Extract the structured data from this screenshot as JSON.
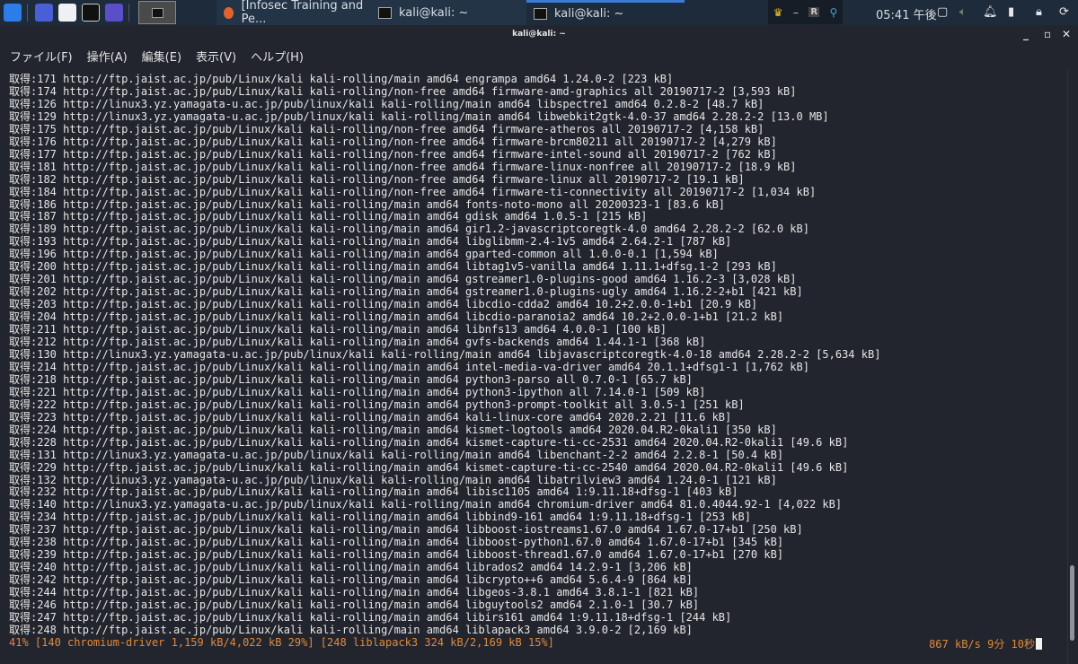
{
  "taskbar": {
    "tasks": [
      {
        "label": "[Infosec Training and Pe...",
        "icon": "firefox-icon"
      },
      {
        "label": "kali@kali: ~",
        "icon": "terminal-icon"
      },
      {
        "label": "kali@kali: ~",
        "icon": "terminal-icon",
        "active": true
      }
    ],
    "clock": "05:41 午後",
    "tray_letter": "R",
    "accent": "#3a7bd5"
  },
  "window": {
    "title": "kali@kali: ~"
  },
  "menubar": [
    "ファイル(F)",
    "操作(A)",
    "編集(E)",
    "表示(V)",
    "ヘルプ(H)"
  ],
  "terminal": {
    "lines": [
      "取得:171 http://ftp.jaist.ac.jp/pub/Linux/kali kali-rolling/main amd64 engrampa amd64 1.24.0-2 [223 kB]",
      "取得:174 http://ftp.jaist.ac.jp/pub/Linux/kali kali-rolling/non-free amd64 firmware-amd-graphics all 20190717-2 [3,593 kB]",
      "取得:126 http://linux3.yz.yamagata-u.ac.jp/pub/linux/kali kali-rolling/main amd64 libspectre1 amd64 0.2.8-2 [48.7 kB]",
      "取得:129 http://linux3.yz.yamagata-u.ac.jp/pub/linux/kali kali-rolling/main amd64 libwebkit2gtk-4.0-37 amd64 2.28.2-2 [13.0 MB]",
      "取得:175 http://ftp.jaist.ac.jp/pub/Linux/kali kali-rolling/non-free amd64 firmware-atheros all 20190717-2 [4,158 kB]",
      "取得:176 http://ftp.jaist.ac.jp/pub/Linux/kali kali-rolling/non-free amd64 firmware-brcm80211 all 20190717-2 [4,279 kB]",
      "取得:177 http://ftp.jaist.ac.jp/pub/Linux/kali kali-rolling/non-free amd64 firmware-intel-sound all 20190717-2 [762 kB]",
      "取得:181 http://ftp.jaist.ac.jp/pub/Linux/kali kali-rolling/non-free amd64 firmware-linux-nonfree all 20190717-2 [18.9 kB]",
      "取得:182 http://ftp.jaist.ac.jp/pub/Linux/kali kali-rolling/non-free amd64 firmware-linux all 20190717-2 [19.1 kB]",
      "取得:184 http://ftp.jaist.ac.jp/pub/Linux/kali kali-rolling/non-free amd64 firmware-ti-connectivity all 20190717-2 [1,034 kB]",
      "取得:186 http://ftp.jaist.ac.jp/pub/Linux/kali kali-rolling/main amd64 fonts-noto-mono all 20200323-1 [83.6 kB]",
      "取得:187 http://ftp.jaist.ac.jp/pub/Linux/kali kali-rolling/main amd64 gdisk amd64 1.0.5-1 [215 kB]",
      "取得:189 http://ftp.jaist.ac.jp/pub/Linux/kali kali-rolling/main amd64 gir1.2-javascriptcoregtk-4.0 amd64 2.28.2-2 [62.0 kB]",
      "取得:193 http://ftp.jaist.ac.jp/pub/Linux/kali kali-rolling/main amd64 libglibmm-2.4-1v5 amd64 2.64.2-1 [787 kB]",
      "取得:196 http://ftp.jaist.ac.jp/pub/Linux/kali kali-rolling/main amd64 gparted-common all 1.0.0-0.1 [1,594 kB]",
      "取得:200 http://ftp.jaist.ac.jp/pub/Linux/kali kali-rolling/main amd64 libtag1v5-vanilla amd64 1.11.1+dfsg.1-2 [293 kB]",
      "取得:201 http://ftp.jaist.ac.jp/pub/Linux/kali kali-rolling/main amd64 gstreamer1.0-plugins-good amd64 1.16.2-3 [3,028 kB]",
      "取得:202 http://ftp.jaist.ac.jp/pub/Linux/kali kali-rolling/main amd64 gstreamer1.0-plugins-ugly amd64 1.16.2-2+b1 [421 kB]",
      "取得:203 http://ftp.jaist.ac.jp/pub/Linux/kali kali-rolling/main amd64 libcdio-cdda2 amd64 10.2+2.0.0-1+b1 [20.9 kB]",
      "取得:204 http://ftp.jaist.ac.jp/pub/Linux/kali kali-rolling/main amd64 libcdio-paranoia2 amd64 10.2+2.0.0-1+b1 [21.2 kB]",
      "取得:211 http://ftp.jaist.ac.jp/pub/Linux/kali kali-rolling/main amd64 libnfs13 amd64 4.0.0-1 [100 kB]",
      "取得:212 http://ftp.jaist.ac.jp/pub/Linux/kali kali-rolling/main amd64 gvfs-backends amd64 1.44.1-1 [368 kB]",
      "取得:130 http://linux3.yz.yamagata-u.ac.jp/pub/linux/kali kali-rolling/main amd64 libjavascriptcoregtk-4.0-18 amd64 2.28.2-2 [5,634 kB]",
      "取得:214 http://ftp.jaist.ac.jp/pub/Linux/kali kali-rolling/main amd64 intel-media-va-driver amd64 20.1.1+dfsg1-1 [1,762 kB]",
      "取得:218 http://ftp.jaist.ac.jp/pub/Linux/kali kali-rolling/main amd64 python3-parso all 0.7.0-1 [65.7 kB]",
      "取得:221 http://ftp.jaist.ac.jp/pub/Linux/kali kali-rolling/main amd64 python3-ipython all 7.14.0-1 [509 kB]",
      "取得:222 http://ftp.jaist.ac.jp/pub/Linux/kali kali-rolling/main amd64 python3-prompt-toolkit all 3.0.5-1 [251 kB]",
      "取得:223 http://ftp.jaist.ac.jp/pub/Linux/kali kali-rolling/main amd64 kali-linux-core amd64 2020.2.21 [11.6 kB]",
      "取得:224 http://ftp.jaist.ac.jp/pub/Linux/kali kali-rolling/main amd64 kismet-logtools amd64 2020.04.R2-0kali1 [350 kB]",
      "取得:228 http://ftp.jaist.ac.jp/pub/Linux/kali kali-rolling/main amd64 kismet-capture-ti-cc-2531 amd64 2020.04.R2-0kali1 [49.6 kB]",
      "取得:131 http://linux3.yz.yamagata-u.ac.jp/pub/linux/kali kali-rolling/main amd64 libenchant-2-2 amd64 2.2.8-1 [50.4 kB]",
      "取得:229 http://ftp.jaist.ac.jp/pub/Linux/kali kali-rolling/main amd64 kismet-capture-ti-cc-2540 amd64 2020.04.R2-0kali1 [49.6 kB]",
      "取得:132 http://linux3.yz.yamagata-u.ac.jp/pub/linux/kali kali-rolling/main amd64 libatrilview3 amd64 1.24.0-1 [121 kB]",
      "取得:232 http://ftp.jaist.ac.jp/pub/Linux/kali kali-rolling/main amd64 libisc1105 amd64 1:9.11.18+dfsg-1 [403 kB]",
      "取得:140 http://linux3.yz.yamagata-u.ac.jp/pub/linux/kali kali-rolling/main amd64 chromium-driver amd64 81.0.4044.92-1 [4,022 kB]",
      "取得:234 http://ftp.jaist.ac.jp/pub/Linux/kali kali-rolling/main amd64 libbind9-161 amd64 1:9.11.18+dfsg-1 [253 kB]",
      "取得:237 http://ftp.jaist.ac.jp/pub/Linux/kali kali-rolling/main amd64 libboost-iostreams1.67.0 amd64 1.67.0-17+b1 [250 kB]",
      "取得:238 http://ftp.jaist.ac.jp/pub/Linux/kali kali-rolling/main amd64 libboost-python1.67.0 amd64 1.67.0-17+b1 [345 kB]",
      "取得:239 http://ftp.jaist.ac.jp/pub/Linux/kali kali-rolling/main amd64 libboost-thread1.67.0 amd64 1.67.0-17+b1 [270 kB]",
      "取得:240 http://ftp.jaist.ac.jp/pub/Linux/kali kali-rolling/main amd64 librados2 amd64 14.2.9-1 [3,206 kB]",
      "取得:242 http://ftp.jaist.ac.jp/pub/Linux/kali kali-rolling/main amd64 libcrypto++6 amd64 5.6.4-9 [864 kB]",
      "取得:244 http://ftp.jaist.ac.jp/pub/Linux/kali kali-rolling/main amd64 libgeos-3.8.1 amd64 3.8.1-1 [821 kB]",
      "取得:246 http://ftp.jaist.ac.jp/pub/Linux/kali kali-rolling/main amd64 libguytools2 amd64 2.1.0-1 [30.7 kB]",
      "取得:247 http://ftp.jaist.ac.jp/pub/Linux/kali kali-rolling/main amd64 libirs161 amd64 1:9.11.18+dfsg-1 [244 kB]",
      "取得:248 http://ftp.jaist.ac.jp/pub/Linux/kali kali-rolling/main amd64 liblapack3 amd64 3.9.0-2 [2,169 kB]"
    ],
    "progress_line": "41% [140 chromium-driver 1,159 kB/4,022 kB 29%] [248 liblapack3 324 kB/2,169 kB 15%]",
    "speed_eta": "867 kB/s 9分 10秒",
    "status_color": "#e08a3a"
  }
}
